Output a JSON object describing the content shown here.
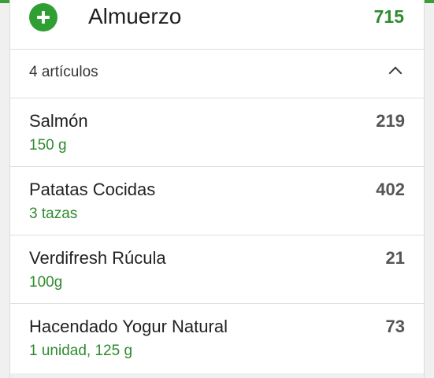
{
  "meal": {
    "title": "Almuerzo",
    "total": "715",
    "count_label": "4 artículos"
  },
  "items": [
    {
      "name": "Salmón",
      "serving": "150  g",
      "calories": "219"
    },
    {
      "name": "Patatas Cocidas",
      "serving": "3  tazas",
      "calories": "402"
    },
    {
      "name": "Verdifresh Rúcula",
      "serving": "100g",
      "calories": "21"
    },
    {
      "name": "Hacendado Yogur Natural",
      "serving": "1 unidad, 125 g",
      "calories": "73"
    }
  ],
  "icons": {
    "add": "plus-icon",
    "collapse": "chevron-up-icon"
  },
  "colors": {
    "accent": "#2f9e33",
    "serving_text": "#2e8b2e"
  }
}
